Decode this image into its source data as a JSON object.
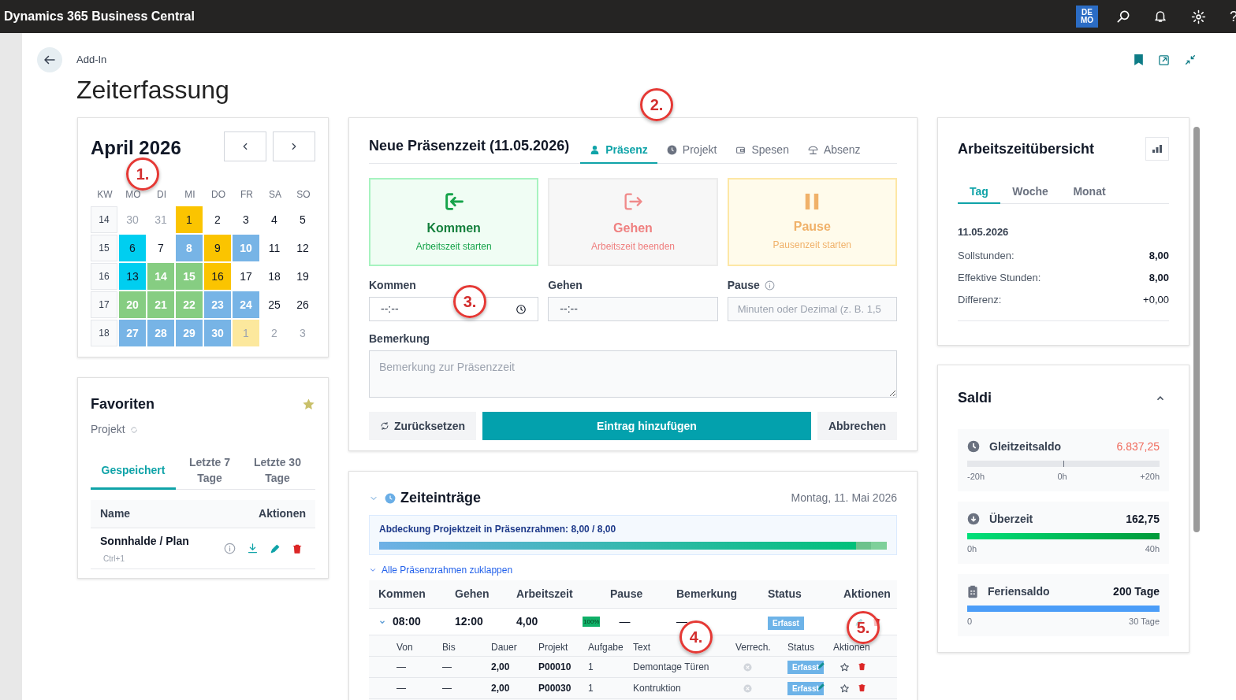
{
  "app_bar": {
    "title": "Dynamics 365 Business Central",
    "badge_lines": [
      "DE",
      "MO"
    ],
    "help": "?"
  },
  "page": {
    "breadcrumb": "Add-In",
    "title": "Zeiterfassung"
  },
  "calendar": {
    "title": "April 2026",
    "headers": [
      "KW",
      "MO",
      "DI",
      "MI",
      "DO",
      "FR",
      "SA",
      "SO"
    ],
    "weeks": [
      {
        "number": "14",
        "days": [
          {
            "label": "30",
            "muted": true
          },
          {
            "label": "31",
            "muted": true
          },
          {
            "label": "1",
            "color": "#fbc400"
          },
          {
            "label": "2"
          },
          {
            "label": "3"
          },
          {
            "label": "4"
          },
          {
            "label": "5"
          }
        ]
      },
      {
        "number": "15",
        "days": [
          {
            "label": "6",
            "color": "#00cef0"
          },
          {
            "label": "7"
          },
          {
            "label": "8",
            "color": "#77b4e6"
          },
          {
            "label": "9",
            "color": "#fbc400"
          },
          {
            "label": "10",
            "color": "#77b4e6"
          },
          {
            "label": "11"
          },
          {
            "label": "12"
          }
        ]
      },
      {
        "number": "16",
        "days": [
          {
            "label": "13",
            "color": "#00cef0"
          },
          {
            "label": "14",
            "color": "#86cd82"
          },
          {
            "label": "15",
            "color": "#86cd82"
          },
          {
            "label": "16",
            "color": "#fbc400"
          },
          {
            "label": "17"
          },
          {
            "label": "18"
          },
          {
            "label": "19"
          }
        ]
      },
      {
        "number": "17",
        "days": [
          {
            "label": "20",
            "color": "#86cd82"
          },
          {
            "label": "21",
            "color": "#86cd82"
          },
          {
            "label": "22",
            "color": "#86cd82"
          },
          {
            "label": "23",
            "color": "#77b4e6"
          },
          {
            "label": "24",
            "color": "#77b4e6"
          },
          {
            "label": "25"
          },
          {
            "label": "26"
          }
        ]
      },
      {
        "number": "18",
        "days": [
          {
            "label": "27",
            "color": "#77b4e6"
          },
          {
            "label": "28",
            "color": "#77b4e6"
          },
          {
            "label": "29",
            "color": "#77b4e6"
          },
          {
            "label": "30",
            "color": "#77b4e6"
          },
          {
            "label": "1",
            "muted": true,
            "color": "#fce89d"
          },
          {
            "label": "2",
            "muted": true
          },
          {
            "label": "3",
            "muted": true
          }
        ]
      }
    ]
  },
  "favorites": {
    "title": "Favoriten",
    "subtitle": "Projekt",
    "tabs": [
      {
        "label": "Gespeichert",
        "selected": true
      },
      {
        "label": "Letzte 7 Tage",
        "selected": false
      },
      {
        "label": "Letzte 30 Tage",
        "selected": false
      }
    ],
    "columns": [
      "Name",
      "Aktionen"
    ],
    "rows": [
      {
        "name": "Sonnhalde / Plan",
        "shortcut": "Ctrl+1"
      }
    ]
  },
  "entry_form": {
    "title": "Neue Präsenzzeit (11.05.2026)",
    "tabs": [
      {
        "label": "Präsenz",
        "selected": true
      },
      {
        "label": "Projekt",
        "selected": false
      },
      {
        "label": "Spesen",
        "selected": false
      },
      {
        "label": "Absenz",
        "selected": false
      }
    ],
    "actions": [
      {
        "kind": "kommen",
        "title": "Kommen",
        "subtitle": "Arbeitszeit starten"
      },
      {
        "kind": "gehen",
        "title": "Gehen",
        "subtitle": "Arbeitszeit beenden"
      },
      {
        "kind": "pause",
        "title": "Pause",
        "subtitle": "Pausenzeit starten"
      }
    ],
    "kommen": {
      "label": "Kommen",
      "value": "--:--"
    },
    "gehen": {
      "label": "Gehen",
      "value": "--:--"
    },
    "pause": {
      "label": "Pause",
      "placeholder": "Minuten oder Dezimal (z. B. 1,5"
    },
    "bemerkung": {
      "label": "Bemerkung",
      "placeholder": "Bemerkung zur Präsenzzeit"
    },
    "buttons": {
      "reset": "Zurücksetzen",
      "add": "Eintrag hinzufügen",
      "cancel": "Abbrechen"
    }
  },
  "time_entries": {
    "title": "Zeiteinträge",
    "date": "Montag, 11. Mai 2026",
    "coverage": {
      "label": "Abdeckung Projektzeit in Präsenzrahmen: 8,00 / 8,00",
      "level": 1
    },
    "collapse_link": "Alle Präsenzrahmen zuklappen",
    "columns": [
      "Kommen",
      "Gehen",
      "Arbeitszeit",
      "Pause",
      "Bemerkung",
      "Status",
      "Aktionen"
    ],
    "rows": [
      {
        "kommen": "08:00",
        "gehen": "12:00",
        "arbeitszeit": "4,00",
        "badge": "100%",
        "pause": "—",
        "bemerkung": "—",
        "status": "Erfasst",
        "expanded": true,
        "sub_columns": [
          "Von",
          "Bis",
          "Dauer",
          "Projekt",
          "Aufgabe",
          "Text",
          "Verrech.",
          "Status",
          "Aktionen"
        ],
        "sub_rows": [
          {
            "von": "—",
            "bis": "—",
            "dauer": "2,00",
            "projekt": "P00010",
            "aufgabe": "1",
            "text": "Demontage Türen",
            "status": "Erfasst"
          },
          {
            "von": "—",
            "bis": "—",
            "dauer": "2,00",
            "projekt": "P00030",
            "aufgabe": "1",
            "text": "Kontruktion",
            "status": "Erfasst"
          }
        ]
      }
    ]
  },
  "overview": {
    "title": "Arbeitszeitübersicht",
    "tabs": [
      {
        "label": "Tag",
        "selected": true
      },
      {
        "label": "Woche",
        "selected": false
      },
      {
        "label": "Monat",
        "selected": false
      }
    ],
    "date": "11.05.2026",
    "rows": [
      {
        "label": "Sollstunden:",
        "value": "8,00",
        "bold": true
      },
      {
        "label": "Effektive Stunden:",
        "value": "8,00",
        "bold": true
      },
      {
        "label": "Differenz:",
        "value": "+0,00",
        "bold": false
      }
    ]
  },
  "saldi": {
    "title": "Saldi",
    "expanded": true,
    "items": [
      {
        "kind": "balance",
        "label": "Gleitzeitsaldo",
        "value": "6.837,25",
        "alert": true,
        "scale": [
          "-20h",
          "0h",
          "+20h"
        ]
      },
      {
        "kind": "overtime",
        "label": "Überzeit",
        "value": "162,75",
        "alert": false,
        "level": 1,
        "scale": [
          "0h",
          "40h"
        ]
      },
      {
        "kind": "vacation",
        "label": "Feriensaldo",
        "value": "200 Tage",
        "alert": false,
        "level": 1,
        "scale": [
          "0",
          "30 Tage"
        ]
      }
    ]
  },
  "annotations": [
    {
      "label": "1."
    },
    {
      "label": "2."
    },
    {
      "label": "3."
    },
    {
      "label": "4."
    },
    {
      "label": "5."
    }
  ]
}
